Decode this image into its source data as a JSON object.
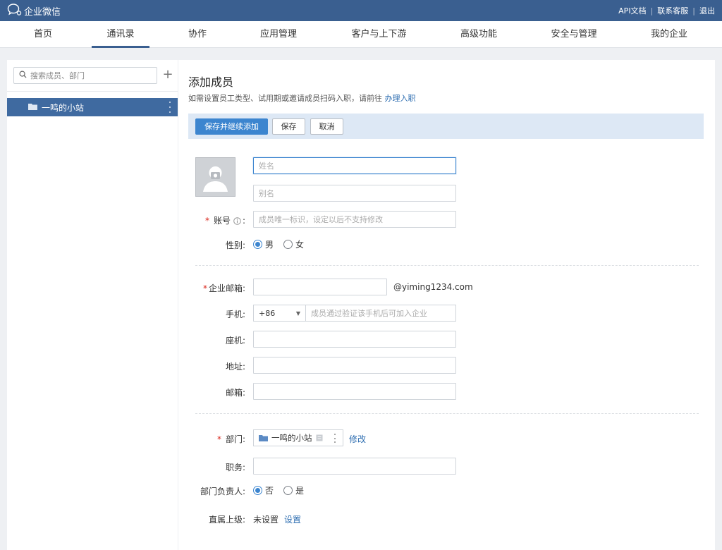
{
  "app": {
    "name": "企业微信"
  },
  "toplinks": [
    "API文档",
    "联系客服",
    "退出"
  ],
  "nav": [
    "首页",
    "通讯录",
    "协作",
    "应用管理",
    "客户与上下游",
    "高级功能",
    "安全与管理",
    "我的企业"
  ],
  "sidebar": {
    "search_placeholder": "搜索成员、部门",
    "department": "一鸣的小站"
  },
  "main": {
    "title": "添加成员",
    "subtitle_prefix": "如需设置员工类型、试用期或邀请成员扫码入职，请前往",
    "subtitle_link": "办理入职",
    "buttons": {
      "save_continue": "保存并继续添加",
      "save": "保存",
      "cancel": "取消"
    }
  },
  "form": {
    "name_placeholder": "姓名",
    "alias_placeholder": "别名",
    "account_label": "账号",
    "account_placeholder": "成员唯一标识，设定以后不支持修改",
    "gender_label": "性别:",
    "gender_male": "男",
    "gender_female": "女",
    "email_label": "企业邮箱:",
    "email_suffix": "@yiming1234.com",
    "mobile_label": "手机:",
    "mobile_code": "+86",
    "mobile_placeholder": "成员通过验证该手机后可加入企业",
    "landline_label": "座机:",
    "address_label": "地址:",
    "mailbox_label": "邮箱:",
    "dept_label": "部门:",
    "dept_value": "一鸣的小站",
    "dept_modify": "修改",
    "position_label": "职务:",
    "leader_label": "部门负责人:",
    "leader_no": "否",
    "leader_yes": "是",
    "superior_label": "直属上级:",
    "superior_value": "未设置",
    "superior_set": "设置"
  },
  "colors": {
    "topbar": "#3a5f90",
    "primary": "#3c85cf",
    "selected": "#3f6aa0",
    "link": "#2b6cb0",
    "required": "#d9261c"
  }
}
